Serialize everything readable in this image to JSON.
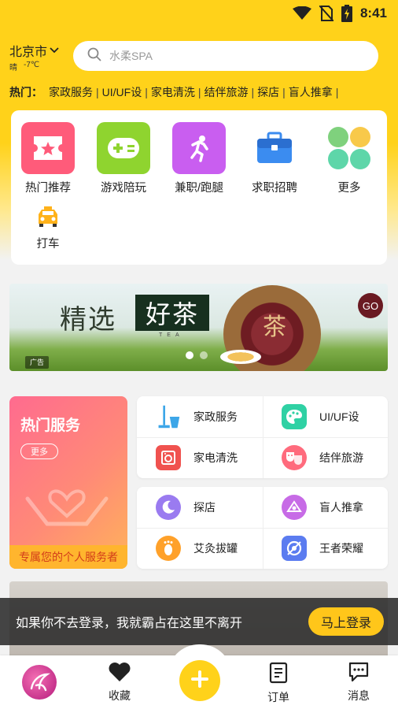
{
  "status_bar": {
    "time": "8:41",
    "icons": [
      "wifi-icon",
      "no-sim-icon",
      "battery-charging-icon"
    ]
  },
  "header": {
    "city": "北京市",
    "weather": {
      "condition": "晴",
      "temperature": "-7℃"
    },
    "search": {
      "placeholder": "水柔SPA",
      "icon": "search-icon"
    }
  },
  "hot_bar": {
    "label": "热门：",
    "items": [
      "家政服务",
      "UI/UF设",
      "家电清洗",
      "结伴旅游",
      "探店",
      "盲人推拿"
    ]
  },
  "categories": [
    {
      "label": "热门推荐",
      "icon": "ticket-star-icon",
      "color": "#ff5b7a"
    },
    {
      "label": "游戏陪玩",
      "icon": "gamepad-icon",
      "color": "#8fd42f"
    },
    {
      "label": "兼职/跑腿",
      "icon": "running-person-icon",
      "color": "#c95ef0"
    },
    {
      "label": "求职招聘",
      "icon": "briefcase-icon",
      "color": "#3b8cf0"
    },
    {
      "label": "更多",
      "icon": "clover-icon",
      "color": "#6fd19a"
    },
    {
      "label": "打车",
      "icon": "taxi-icon",
      "color": "#ffb21a"
    }
  ],
  "banner": {
    "title_part1": "精选",
    "title_part2": "好茶",
    "subtitle": "TEA",
    "product_text": "茶",
    "badge": "GO",
    "ad_tag": "广告",
    "slide_count": 2,
    "active_slide": 1
  },
  "hot_services": {
    "title": "热门服务",
    "more_label": "更多",
    "slogan": "专属您的个人服务者",
    "items": [
      {
        "label": "家政服务",
        "icon": "mop-bucket-icon",
        "color": "#3da6e8"
      },
      {
        "label": "UI/UF设",
        "icon": "palette-icon",
        "color": "#2fd1a4"
      },
      {
        "label": "家电清洗",
        "icon": "appliance-icon",
        "color": "#f0524f"
      },
      {
        "label": "结伴旅游",
        "icon": "masks-icon",
        "color": "#ff6b7d"
      },
      {
        "label": "探店",
        "icon": "moon-icon",
        "color": "#9a7bf0"
      },
      {
        "label": "盲人推拿",
        "icon": "massage-icon",
        "color": "#c76be6"
      },
      {
        "label": "艾灸拔罐",
        "icon": "footprint-icon",
        "color": "#ffa12a"
      },
      {
        "label": "王者荣耀",
        "icon": "game-emblem-icon",
        "color": "#5b7cf0"
      }
    ]
  },
  "login_toast": {
    "message": "如果你不去登录，我就霸占在这里不离开",
    "button": "马上登录"
  },
  "tab_bar": {
    "items": [
      {
        "label": "",
        "icon": "app-logo-icon"
      },
      {
        "label": "收藏",
        "icon": "heart-icon"
      },
      {
        "label": "",
        "icon": "plus-icon"
      },
      {
        "label": "订单",
        "icon": "order-list-icon"
      },
      {
        "label": "消息",
        "icon": "message-icon"
      }
    ],
    "accent": "#ffd21a"
  }
}
